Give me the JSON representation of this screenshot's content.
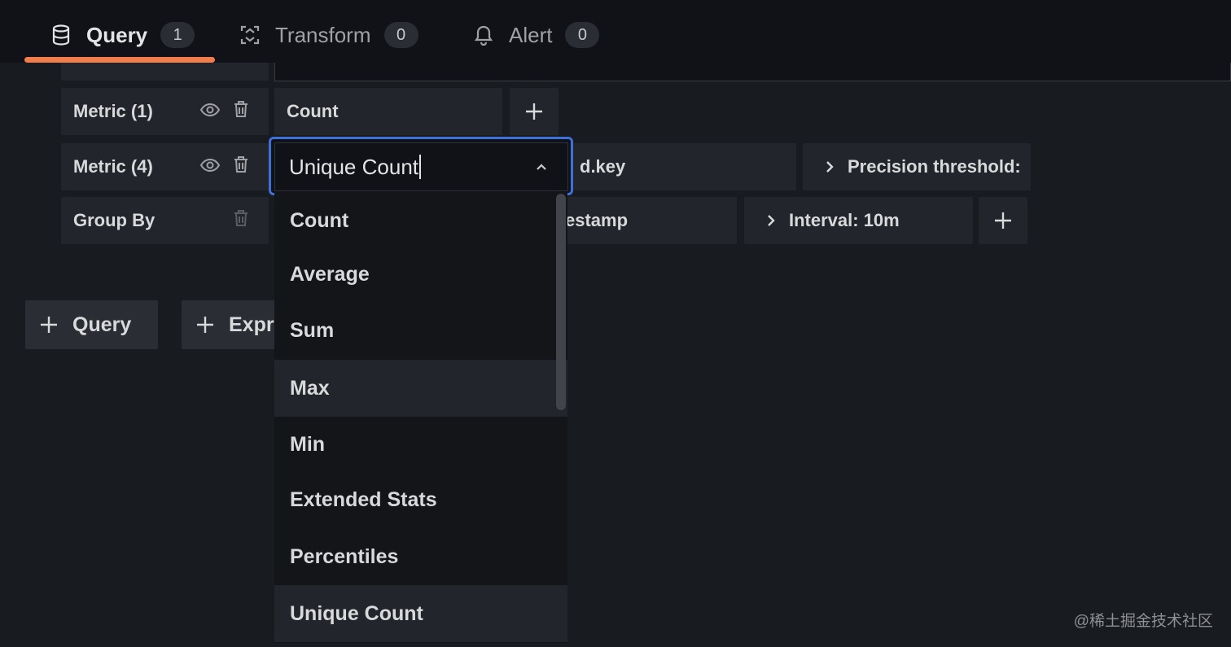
{
  "tabs": [
    {
      "label": "Query",
      "badge": "1",
      "icon": "database-icon",
      "active": true
    },
    {
      "label": "Transform",
      "badge": "0",
      "icon": "transform-icon",
      "active": false
    },
    {
      "label": "Alert",
      "badge": "0",
      "icon": "bell-icon",
      "active": false
    }
  ],
  "rows": {
    "metric1": {
      "label": "Metric (1)",
      "value": "Count"
    },
    "metric4": {
      "label": "Metric (4)",
      "field": "d.key",
      "option": "Precision threshold:"
    },
    "group_by": {
      "label": "Group By",
      "field": "estamp",
      "option": "Interval: 10m"
    }
  },
  "buttons": {
    "add_query": "Query",
    "add_expression": "Expr"
  },
  "select": {
    "value": "Unique Count",
    "options": [
      "Count",
      "Average",
      "Sum",
      "Max",
      "Min",
      "Extended Stats",
      "Percentiles",
      "Unique Count"
    ],
    "hovered": "Max",
    "selected": "Unique Count"
  },
  "watermark": "@稀土掘金技术社区",
  "colors": {
    "accent_tab": "#f07d4a",
    "focus_border": "#3d71d9",
    "background": "#181b1f"
  }
}
